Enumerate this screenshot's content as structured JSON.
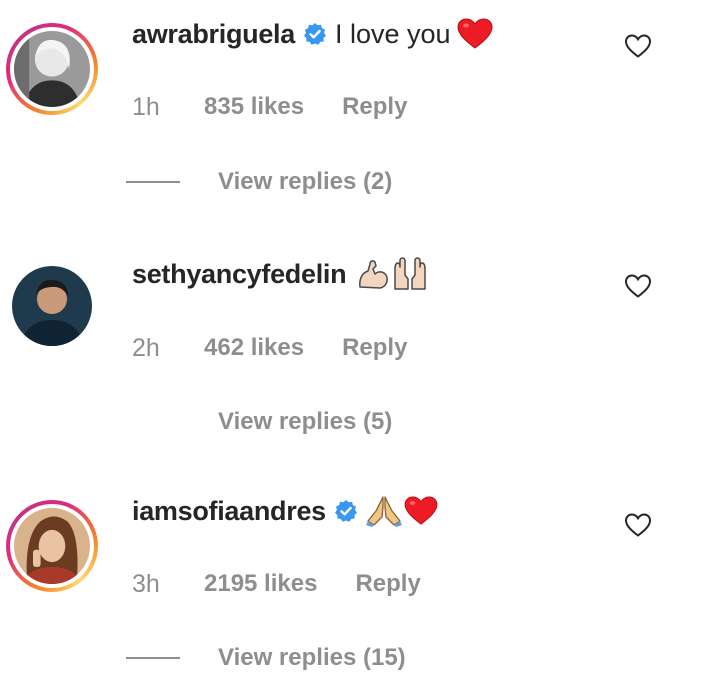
{
  "comments": [
    {
      "username": "awrabriguela",
      "verified": true,
      "text": "I love you",
      "emoji": [
        "red-heart"
      ],
      "time": "1h",
      "likes": "835 likes",
      "reply": "Reply",
      "view_replies": "View replies (2)",
      "has_story_ring": true
    },
    {
      "username": "sethyancyfedelin",
      "verified": false,
      "text": "",
      "emoji": [
        "flexed-biceps",
        "raising-hands"
      ],
      "time": "2h",
      "likes": "462 likes",
      "reply": "Reply",
      "view_replies": "View replies (5)",
      "has_story_ring": false
    },
    {
      "username": "iamsofiaandres",
      "verified": true,
      "text": "",
      "emoji": [
        "folded-hands",
        "red-heart"
      ],
      "time": "3h",
      "likes": "2195 likes",
      "reply": "Reply",
      "view_replies": "View replies (15)",
      "has_story_ring": true
    }
  ],
  "colors": {
    "text": "#262626",
    "secondary": "#8e8e8e",
    "verified_blue": "#3897f0",
    "heart_red": "#ed1c24"
  }
}
